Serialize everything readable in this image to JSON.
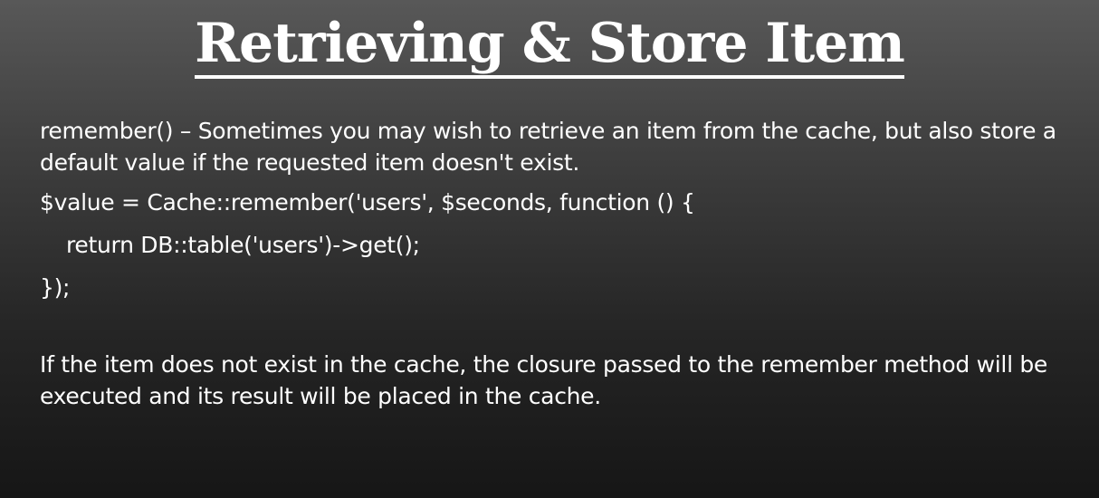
{
  "slide": {
    "title": "Retrieving & Store Item",
    "intro": "remember() – Sometimes you may wish to retrieve an item from the cache, but also store a default value if the requested item doesn't exist.",
    "code": [
      "$value = Cache::remember('users', $seconds, function () {",
      "return DB::table('users')->get();",
      "});"
    ],
    "outro": "If the item does not exist in the cache, the closure passed to the remember method will be executed and its result will be placed in the cache."
  },
  "colors": {
    "text": "#ffffff",
    "background_top": "#585858",
    "background_bottom": "#161616"
  }
}
